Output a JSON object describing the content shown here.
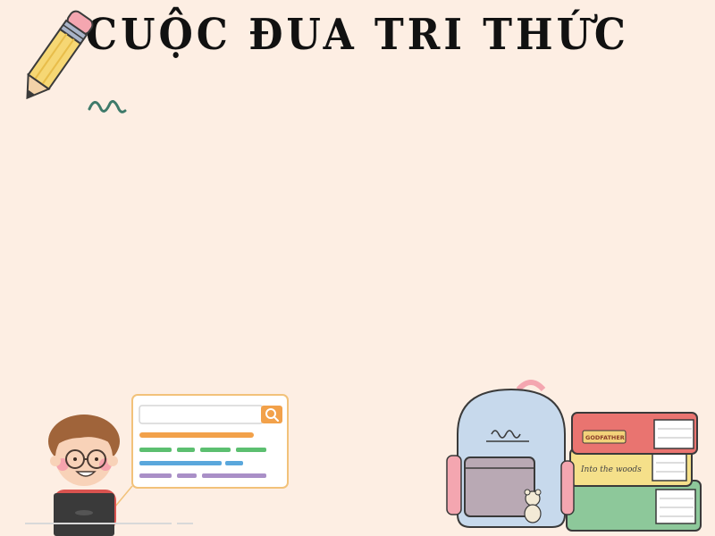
{
  "slide": {
    "title": "CUỘC ĐUA TRI THỨC"
  },
  "illustrations": {
    "pencil": "pencil-illustration",
    "kid": "kid-with-laptop-illustration",
    "search": "search-box-illustration",
    "backpack": "backpack-illustration",
    "books": "book-stack-illustration"
  },
  "book_labels": {
    "top": "GODFATHER",
    "middle": "Into the woods"
  },
  "colors": {
    "background": "#fdeee3",
    "title": "#111111",
    "accent_orange": "#f2a14a",
    "accent_green": "#5cbf70",
    "accent_blue": "#5aa7dc",
    "accent_purple": "#a98fc7"
  }
}
